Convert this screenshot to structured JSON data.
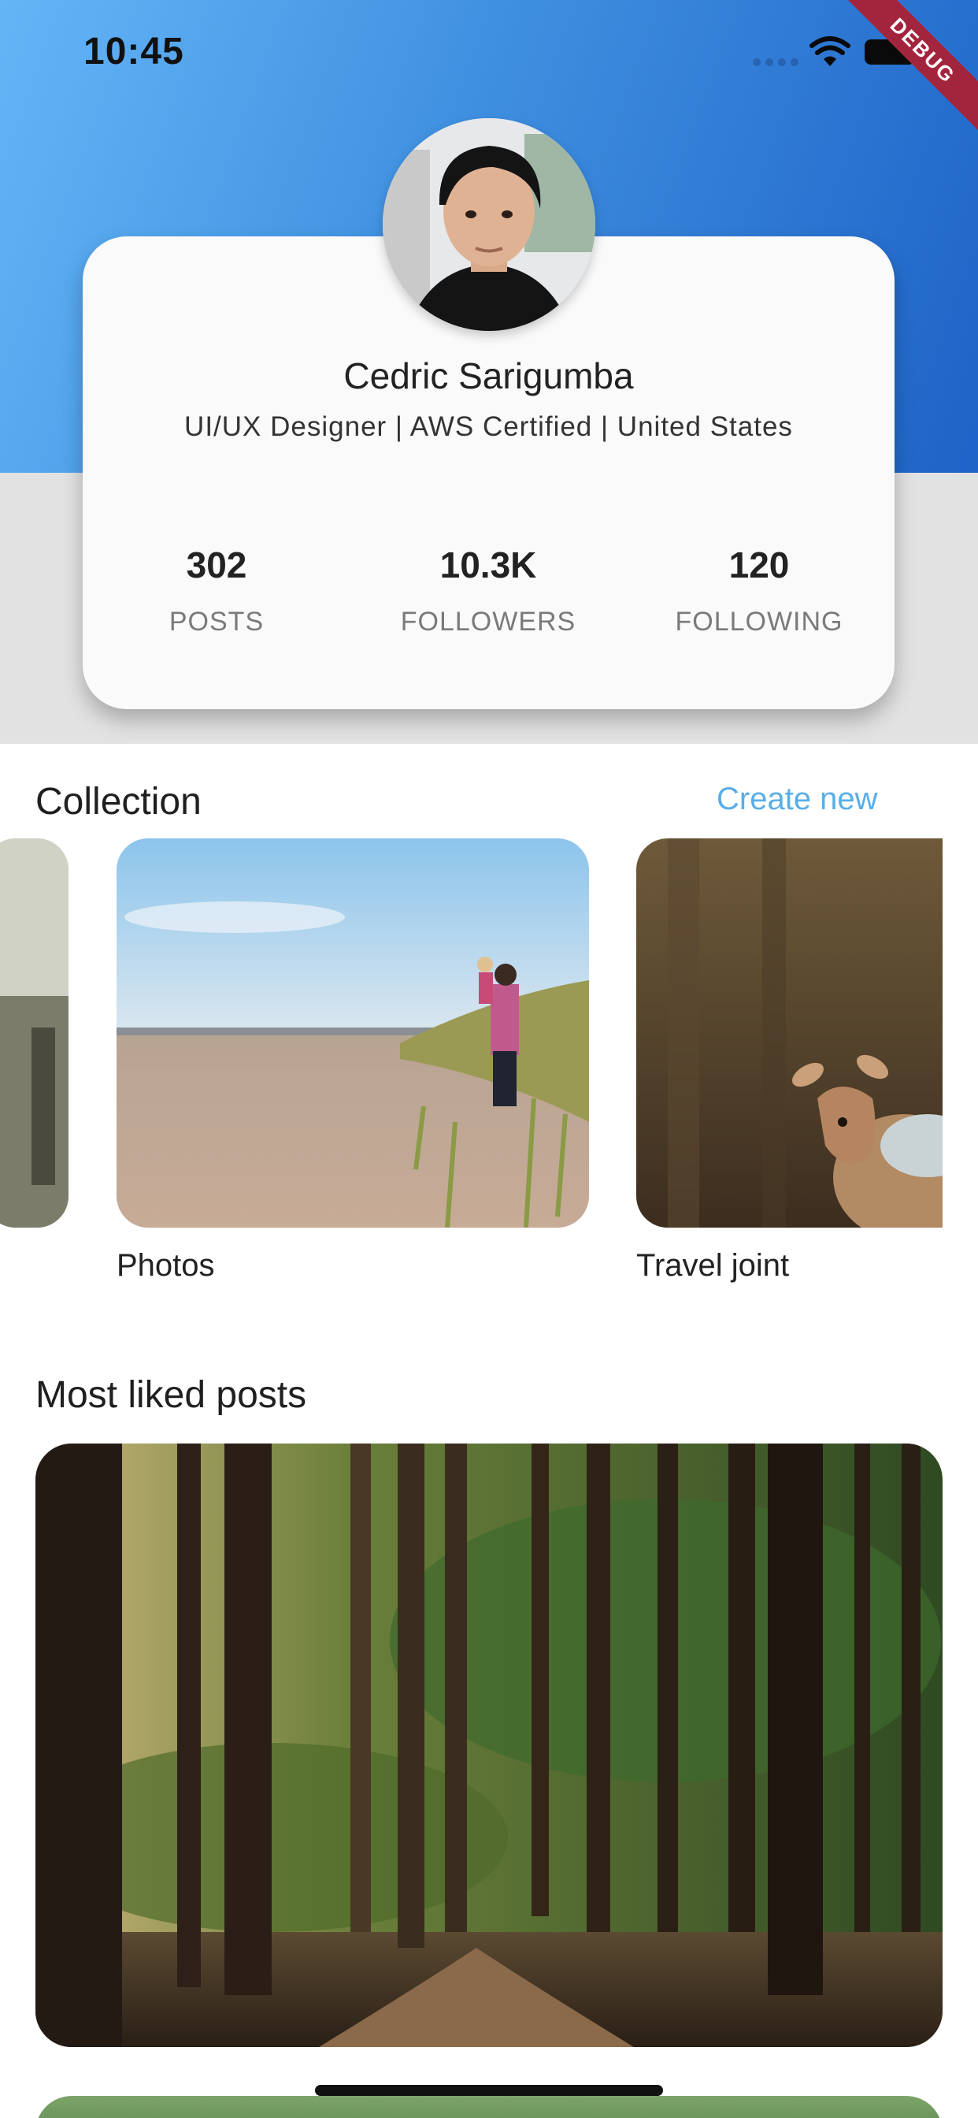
{
  "status_bar": {
    "time": "10:45",
    "icons": [
      "signal-icon",
      "wifi-icon",
      "battery-icon"
    ],
    "debug_banner": "DEBUG"
  },
  "profile": {
    "name": "Cedric Sarigumba",
    "bio": "UI/UX Designer | AWS Certified | United States",
    "avatar": "avatar-photo",
    "stats": [
      {
        "value": "302",
        "label": "POSTS"
      },
      {
        "value": "10.3K",
        "label": "FOLLOWERS"
      },
      {
        "value": "120",
        "label": "FOLLOWING"
      }
    ]
  },
  "collection": {
    "title": "Collection",
    "action_label": "Create new",
    "items": [
      {
        "caption": "Photos",
        "image": "beach-photo"
      },
      {
        "caption": "Travel joint",
        "image": "deer-photo"
      }
    ]
  },
  "posts": {
    "title": "Most liked posts",
    "items": [
      {
        "image": "forest-photo"
      },
      {
        "image": "landscape-photo"
      }
    ]
  },
  "colors": {
    "header_gradient_start": "#64b5f6",
    "header_gradient_end": "#1e63c7",
    "accent": "#5aaee8",
    "card_background": "#fafafa",
    "debug_ribbon": "#a3253d"
  }
}
